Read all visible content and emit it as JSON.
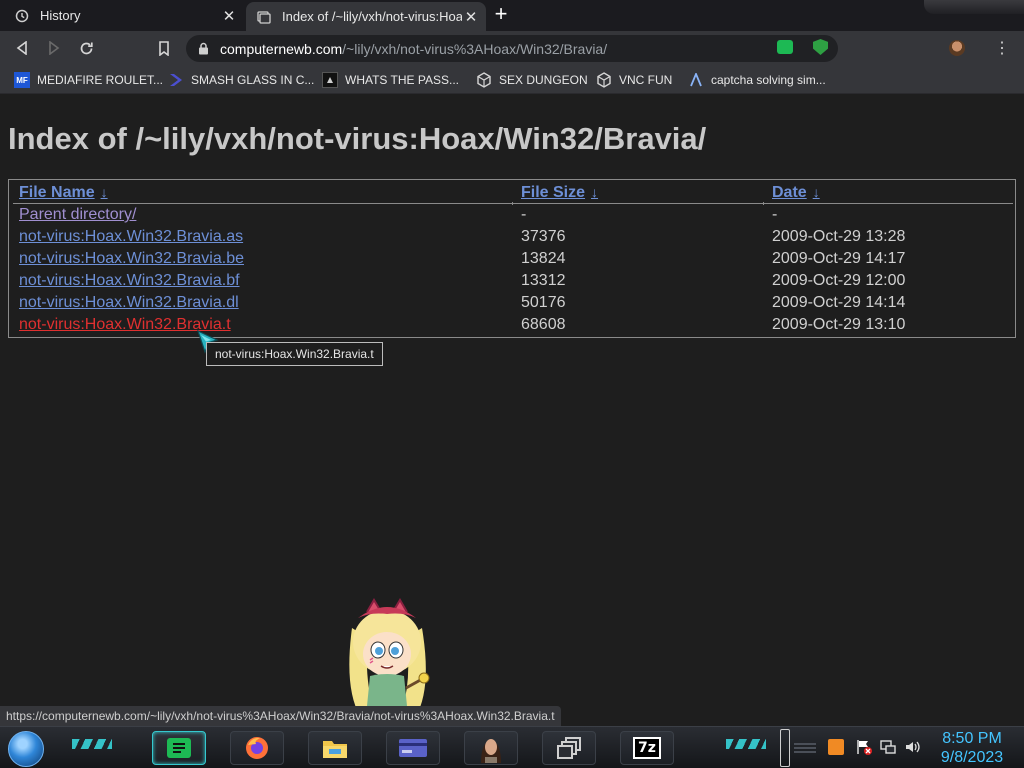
{
  "tabs": [
    {
      "label": "History",
      "icon": "history-icon",
      "active": false
    },
    {
      "label": "Index of /~lily/vxh/not-virus:Hoax/Win32/Bravia/",
      "icon": "page-icon",
      "active": true
    }
  ],
  "toolbar": {
    "url_host": "computernewb.com",
    "url_path": "/~lily/vxh/not-virus%3AHoax/Win32/Bravia/"
  },
  "bookmarks": [
    {
      "label": "MEDIAFIRE ROULET...",
      "icon_text": "MF",
      "color": "#1e57d6"
    },
    {
      "label": "SMASH GLASS IN C...",
      "icon_text": "",
      "color": "#4b4fd0"
    },
    {
      "label": "WHATS THE PASS...",
      "icon_text": "",
      "color": "#222222"
    },
    {
      "label": "SEX DUNGEON",
      "icon_text": "",
      "color": "#cfcfcf"
    },
    {
      "label": "VNC FUN",
      "icon_text": "",
      "color": "#cfcfcf"
    },
    {
      "label": "captcha solving sim...",
      "icon_text": "",
      "color": "#8ab4f8"
    }
  ],
  "page": {
    "title": "Index of /~lily/vxh/not-virus:Hoax/Win32/Bravia/",
    "columns": [
      "File Name",
      "File Size",
      "Date"
    ],
    "sort_arrow": "↓",
    "rows": [
      {
        "name": "Parent directory/",
        "size": "-",
        "date": "-"
      },
      {
        "name": "not-virus:Hoax.Win32.Bravia.as",
        "size": "37376",
        "date": "2009-Oct-29 13:28"
      },
      {
        "name": "not-virus:Hoax.Win32.Bravia.be",
        "size": "13824",
        "date": "2009-Oct-29 14:17"
      },
      {
        "name": "not-virus:Hoax.Win32.Bravia.bf",
        "size": "13312",
        "date": "2009-Oct-29 12:00"
      },
      {
        "name": "not-virus:Hoax.Win32.Bravia.dl",
        "size": "50176",
        "date": "2009-Oct-29 14:14"
      },
      {
        "name": "not-virus:Hoax.Win32.Bravia.t",
        "size": "68608",
        "date": "2009-Oct-29 13:10"
      }
    ],
    "tooltip": "not-virus:Hoax.Win32.Bravia.t"
  },
  "statusbar": {
    "text": "https://computernewb.com/~lily/vxh/not-virus%3AHoax/Win32/Bravia/not-virus%3AHoax.Win32.Bravia.t"
  },
  "taskbar": {
    "apps": [
      "spotify-icon",
      "firefox-icon",
      "file-explorer-icon",
      "card-app-icon",
      "portrait-app-icon",
      "window-stack-icon",
      "7zip-icon"
    ],
    "seven_zip_label": "7z",
    "time": "8:50 PM",
    "date": "9/8/2023"
  },
  "colors": {
    "link": "#6d8fd6",
    "visited": "#a08fd0",
    "hover": "#e03030",
    "clock": "#44c5ff"
  }
}
